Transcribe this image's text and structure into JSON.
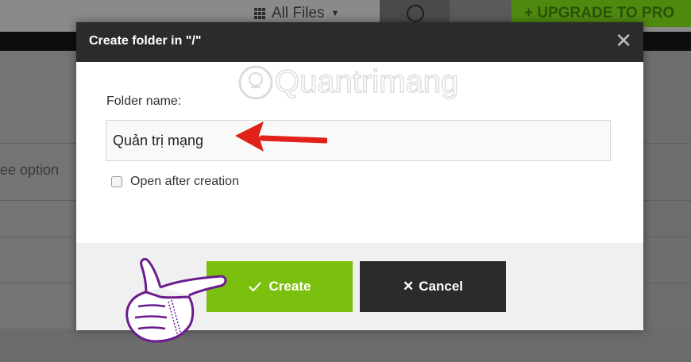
{
  "background": {
    "view_label": "All Files",
    "upgrade_label": "+ UPGRADE TO PRO",
    "options_text": "ee option"
  },
  "dialog": {
    "title": "Create folder in \"/\"",
    "close_symbol": "✕",
    "watermark": "Quantrimang",
    "folder_name_label": "Folder name:",
    "folder_name_value": "Quản trị mạng",
    "open_after_label": "Open after creation",
    "open_after_checked": false,
    "create_label": "Create",
    "cancel_label": "Cancel",
    "create_icon": "checkmark-icon",
    "cancel_icon": "x-icon"
  },
  "colors": {
    "create_button": "#7cc00f",
    "cancel_button": "#2b2b2b",
    "header": "#2b2b2b",
    "arrow": "#e0221a"
  }
}
